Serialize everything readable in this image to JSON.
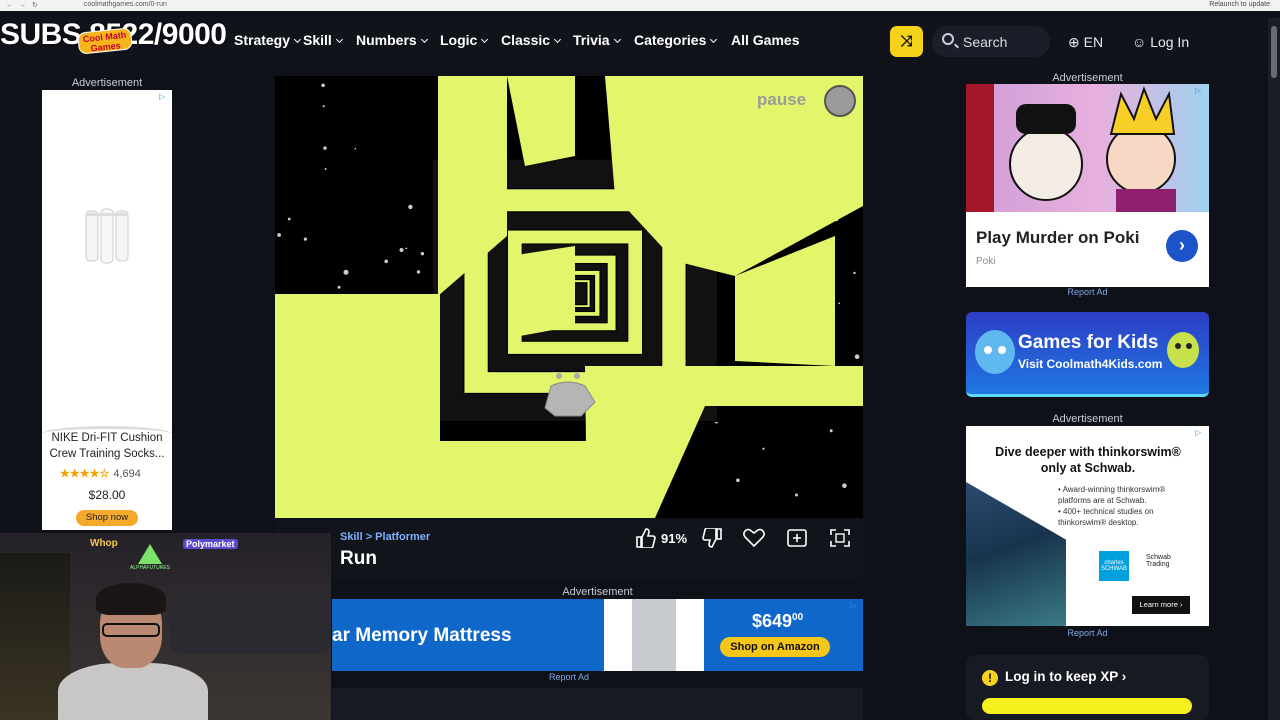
{
  "browser": {
    "url": "coolmathgames.com/0-run",
    "relaunch": "Relaunch to update"
  },
  "overlay": {
    "subs": "SUBS 8522/9000",
    "logo_text": "Cool Math Games"
  },
  "nav": {
    "items": [
      {
        "label": "Strategy",
        "dropdown": true
      },
      {
        "label": "Skill",
        "dropdown": true
      },
      {
        "label": "Numbers",
        "dropdown": true
      },
      {
        "label": "Logic",
        "dropdown": true
      },
      {
        "label": "Classic",
        "dropdown": true
      },
      {
        "label": "Trivia",
        "dropdown": true
      },
      {
        "label": "Categories",
        "dropdown": true
      },
      {
        "label": "All Games",
        "dropdown": false
      }
    ],
    "search_placeholder": "Search",
    "language": "EN",
    "login": "Log In",
    "accent": "#f4d21a"
  },
  "left_ad": {
    "label": "Advertisement",
    "product": "NIKE Dri-FIT Cushion Crew Training Socks...",
    "rating": "★★★★☆",
    "reviews": "4,694",
    "price": "$28.00",
    "cta": "Shop now"
  },
  "game": {
    "pause_label": "pause",
    "category": "Skill",
    "subcategory": "Platformer",
    "title": "Run",
    "like_percent": "91%",
    "tunnel_color": "#e3f56a"
  },
  "bottom_ad": {
    "label": "Advertisement",
    "headline": "ar Memory Mattress",
    "price": "$649",
    "price_cents": "00",
    "cta": "Shop on Amazon",
    "report": "Report Ad"
  },
  "right": {
    "ad1_label": "Advertisement",
    "poki_title": "Play Murder on Poki",
    "poki_sub": "Poki",
    "report1": "Report Ad",
    "kids_title": "Games for Kids",
    "kids_sub": "Visit Coolmath4Kids.com",
    "ad2_label": "Advertisement",
    "schwab_headline": "Dive deeper with thinkorswim® only at Schwab.",
    "schwab_bullets": [
      "• Award-winning thinkorswim® platforms are at Schwab.",
      "• 400+ technical studies on thinkorswim® desktop."
    ],
    "schwab_logo1": "charles SCHWAB",
    "schwab_logo2": "Schwab Trading",
    "schwab_cta": "Learn more ›",
    "report2": "Report Ad",
    "xp_text": "Log in to keep XP"
  },
  "webcam": {
    "sponsor1": "Whop",
    "sponsor2": "Polymarket",
    "sponsor3": "ALPHAFUTURES"
  }
}
